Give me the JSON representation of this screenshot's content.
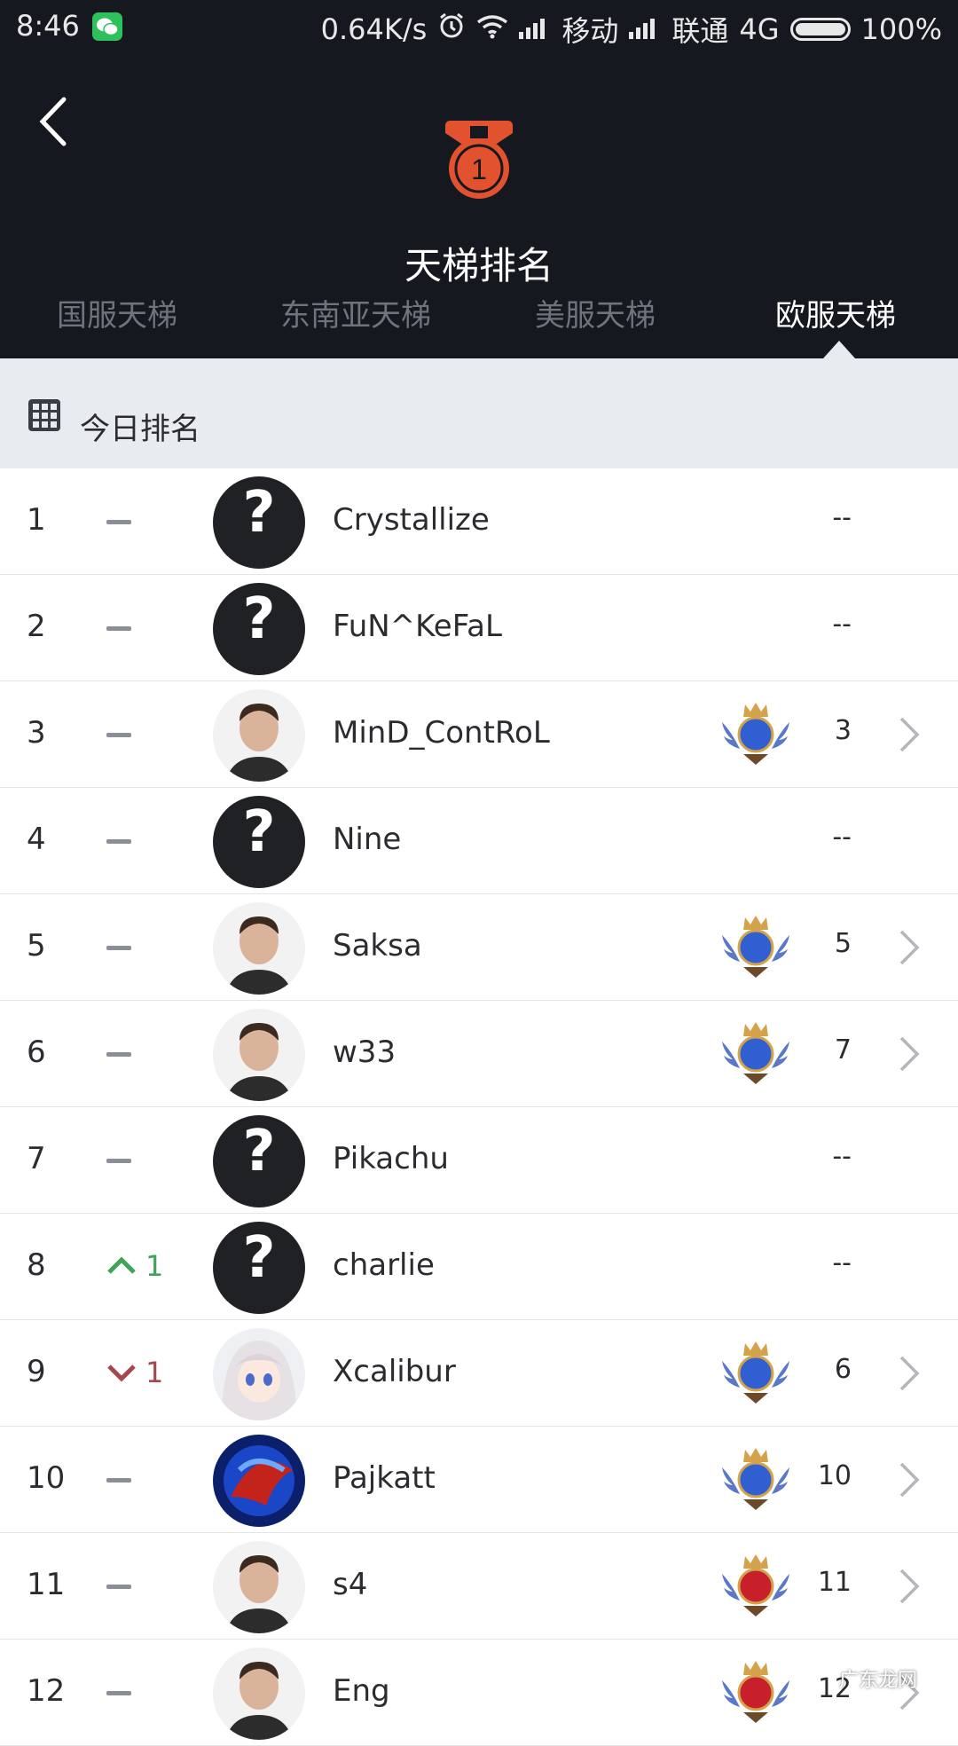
{
  "status_bar": {
    "time": "8:46",
    "net_speed": "0.64K/s",
    "carrier1": "移动",
    "carrier2": "联通",
    "network": "4G",
    "battery": "100%"
  },
  "header": {
    "title": "天梯排名",
    "medal_number": "1",
    "tabs": [
      "国服天梯",
      "东南亚天梯",
      "美服天梯",
      "欧服天梯"
    ],
    "active_tab": "欧服天梯"
  },
  "section": {
    "title": "今日排名"
  },
  "rows": [
    {
      "rank": "1",
      "change": "none",
      "change_value": "",
      "name": "Crystallize",
      "avatar": "unknown",
      "badge": false,
      "score": "--"
    },
    {
      "rank": "2",
      "change": "none",
      "change_value": "",
      "name": "FuN^KeFaL",
      "avatar": "unknown",
      "badge": false,
      "score": "--"
    },
    {
      "rank": "3",
      "change": "none",
      "change_value": "",
      "name": "MinD_ContRoL",
      "avatar": "photo",
      "badge": true,
      "score": "3"
    },
    {
      "rank": "4",
      "change": "none",
      "change_value": "",
      "name": "Nine",
      "avatar": "unknown",
      "badge": false,
      "score": "--"
    },
    {
      "rank": "5",
      "change": "none",
      "change_value": "",
      "name": "Saksa",
      "avatar": "photo",
      "badge": true,
      "score": "5"
    },
    {
      "rank": "6",
      "change": "none",
      "change_value": "",
      "name": "w33",
      "avatar": "photo",
      "badge": true,
      "score": "7"
    },
    {
      "rank": "7",
      "change": "none",
      "change_value": "",
      "name": "Pikachu",
      "avatar": "unknown",
      "badge": false,
      "score": "--"
    },
    {
      "rank": "8",
      "change": "up",
      "change_value": "1",
      "name": "charlie",
      "avatar": "unknown",
      "badge": false,
      "score": "--"
    },
    {
      "rank": "9",
      "change": "down",
      "change_value": "1",
      "name": "Xcalibur",
      "avatar": "anime",
      "badge": true,
      "score": "6"
    },
    {
      "rank": "10",
      "change": "none",
      "change_value": "",
      "name": "Pajkatt",
      "avatar": "abstract",
      "badge": true,
      "score": "10"
    },
    {
      "rank": "11",
      "change": "none",
      "change_value": "",
      "name": "s4",
      "avatar": "photo",
      "badge": true,
      "badge_variant": "red",
      "score": "11"
    },
    {
      "rank": "12",
      "change": "none",
      "change_value": "",
      "name": "Eng",
      "avatar": "photo",
      "badge": true,
      "badge_variant": "red",
      "score": "12"
    }
  ],
  "watermark": "广东龙网",
  "colors": {
    "header_bg": "#15181e",
    "section_bg": "#e8ebf0",
    "medal": "#e2522e",
    "rank_up": "#3fa35a",
    "rank_down": "#a5484e"
  }
}
